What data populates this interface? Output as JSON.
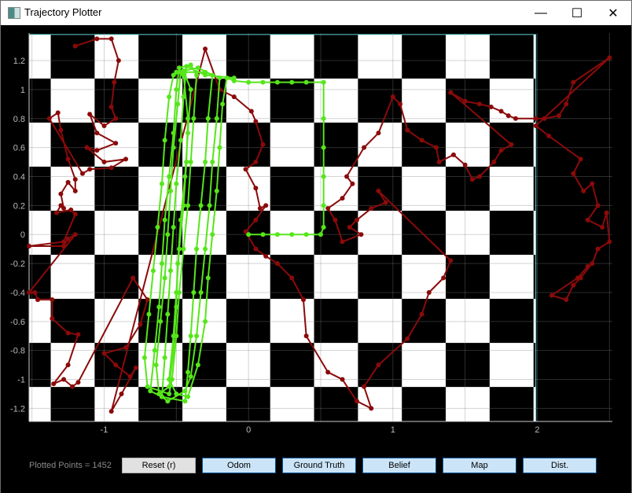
{
  "window": {
    "title": "Trajectory Plotter",
    "controls": {
      "minimize": "—",
      "maximize": "☐",
      "close": "✕"
    }
  },
  "footer": {
    "plotted_points_label": "Plotted Points = 1452",
    "buttons": [
      {
        "label": "Reset (r)",
        "style": "plain",
        "name": "reset-button"
      },
      {
        "label": "Odom",
        "style": "toggle",
        "name": "odom-toggle"
      },
      {
        "label": "Ground Truth",
        "style": "toggle",
        "name": "ground-truth-toggle"
      },
      {
        "label": "Belief",
        "style": "toggle",
        "name": "belief-toggle"
      },
      {
        "label": "Map",
        "style": "toggle",
        "name": "map-toggle"
      },
      {
        "label": "Dist.",
        "style": "toggle",
        "name": "dist-toggle"
      }
    ]
  },
  "colors": {
    "background": "#000000",
    "axis": "#cccccc",
    "board_border": "#5fd3d3",
    "grid": "#3a3a3a",
    "belief": "#8b0a0a",
    "odom": "#55e61a"
  },
  "chart_data": {
    "type": "scatter",
    "title": "",
    "xlabel": "",
    "ylabel": "",
    "xlim": [
      -1.52,
      2.52
    ],
    "ylim": [
      -1.29,
      1.39
    ],
    "x_ticks": [
      -1,
      0,
      1,
      2
    ],
    "y_ticks": [
      -1.2,
      -1,
      -0.8,
      -0.6,
      -0.4,
      -0.2,
      0,
      0.2,
      0.4,
      0.6,
      0.8,
      1,
      1.2
    ],
    "grid": true,
    "map": {
      "type": "checkerboard",
      "x_range": [
        -1.52,
        1.99
      ],
      "y_range": [
        -1.29,
        1.38
      ],
      "square_size": 0.304,
      "origin_corner": [
        -1.37,
        1.38
      ]
    },
    "series": [
      {
        "name": "Odom",
        "color": "#55e61a",
        "points": [
          [
            0,
            0
          ],
          [
            0.1,
            0
          ],
          [
            0.2,
            0
          ],
          [
            0.3,
            0
          ],
          [
            0.4,
            0
          ],
          [
            0.5,
            0
          ],
          [
            0.52,
            0.05
          ],
          [
            0.52,
            0.2
          ],
          [
            0.52,
            0.4
          ],
          [
            0.52,
            0.6
          ],
          [
            0.52,
            0.8
          ],
          [
            0.52,
            1.05
          ],
          [
            0.4,
            1.05
          ],
          [
            0.3,
            1.05
          ],
          [
            0.2,
            1.05
          ],
          [
            0.1,
            1.05
          ],
          [
            0.0,
            1.05
          ],
          [
            -0.1,
            1.06
          ],
          [
            -0.15,
            1.08
          ],
          [
            -0.18,
            0.9
          ],
          [
            -0.2,
            0.6
          ],
          [
            -0.22,
            0.3
          ],
          [
            -0.25,
            0
          ],
          [
            -0.28,
            -0.3
          ],
          [
            -0.3,
            -0.6
          ],
          [
            -0.35,
            -0.9
          ],
          [
            -0.42,
            -1.12
          ],
          [
            -0.5,
            -1.1
          ],
          [
            -0.55,
            -1.0
          ],
          [
            -0.52,
            -0.7
          ],
          [
            -0.5,
            -0.4
          ],
          [
            -0.48,
            -0.1
          ],
          [
            -0.45,
            0.2
          ],
          [
            -0.43,
            0.5
          ],
          [
            -0.42,
            0.8
          ],
          [
            -0.45,
            1.1
          ],
          [
            -0.5,
            1.12
          ],
          [
            -0.35,
            1.15
          ],
          [
            -0.25,
            1.1
          ],
          [
            -0.28,
            0.8
          ],
          [
            -0.3,
            0.5
          ],
          [
            -0.33,
            0.2
          ],
          [
            -0.36,
            -0.1
          ],
          [
            -0.38,
            -0.4
          ],
          [
            -0.4,
            -0.7
          ],
          [
            -0.42,
            -0.95
          ],
          [
            -0.44,
            -1.15
          ],
          [
            -0.6,
            -1.12
          ],
          [
            -0.68,
            -1.08
          ],
          [
            -0.65,
            -0.8
          ],
          [
            -0.62,
            -0.5
          ],
          [
            -0.6,
            -0.2
          ],
          [
            -0.58,
            0.1
          ],
          [
            -0.55,
            0.4
          ],
          [
            -0.52,
            0.7
          ],
          [
            -0.5,
            1.0
          ],
          [
            -0.48,
            1.15
          ],
          [
            -0.4,
            1.17
          ],
          [
            -0.36,
            1.1
          ],
          [
            -0.38,
            0.8
          ],
          [
            -0.4,
            0.5
          ],
          [
            -0.42,
            0.2
          ],
          [
            -0.45,
            -0.1
          ],
          [
            -0.48,
            -0.4
          ],
          [
            -0.5,
            -0.7
          ],
          [
            -0.53,
            -1.0
          ],
          [
            -0.55,
            -1.1
          ],
          [
            -0.7,
            -1.05
          ],
          [
            -0.72,
            -0.85
          ],
          [
            -0.69,
            -0.55
          ],
          [
            -0.66,
            -0.25
          ],
          [
            -0.63,
            0.05
          ],
          [
            -0.6,
            0.35
          ],
          [
            -0.58,
            0.65
          ],
          [
            -0.55,
            0.95
          ],
          [
            -0.52,
            1.1
          ],
          [
            -0.45,
            1.13
          ],
          [
            -0.4,
            1.0
          ],
          [
            -0.42,
            0.7
          ],
          [
            -0.44,
            0.4
          ],
          [
            -0.47,
            0.1
          ],
          [
            -0.49,
            -0.2
          ],
          [
            -0.5,
            -0.5
          ],
          [
            -0.52,
            -0.8
          ],
          [
            -0.55,
            -1.05
          ],
          [
            -0.62,
            -1.1
          ],
          [
            -0.64,
            -0.9
          ],
          [
            -0.61,
            -0.6
          ],
          [
            -0.58,
            -0.3
          ],
          [
            -0.56,
            0
          ],
          [
            -0.54,
            0.3
          ],
          [
            -0.52,
            0.6
          ],
          [
            -0.49,
            0.9
          ],
          [
            -0.47,
            1.12
          ],
          [
            -0.3,
            1.12
          ],
          [
            -0.2,
            1.08
          ],
          [
            -0.22,
            0.8
          ],
          [
            -0.25,
            0.5
          ],
          [
            -0.27,
            0.2
          ],
          [
            -0.3,
            -0.1
          ],
          [
            -0.33,
            -0.4
          ],
          [
            -0.36,
            -0.7
          ],
          [
            -0.4,
            -0.98
          ],
          [
            -0.44,
            -1.08
          ],
          [
            -0.56,
            -1.15
          ],
          [
            -0.6,
            -1.12
          ],
          [
            -0.58,
            -0.85
          ],
          [
            -0.56,
            -0.55
          ],
          [
            -0.54,
            -0.25
          ],
          [
            -0.52,
            0.05
          ],
          [
            -0.5,
            0.35
          ],
          [
            -0.47,
            0.65
          ],
          [
            -0.45,
            0.95
          ],
          [
            -0.43,
            1.16
          ],
          [
            -0.3,
            1.1
          ],
          [
            -0.1,
            1.08
          ]
        ]
      },
      {
        "name": "Belief",
        "color": "#8b0a0a",
        "points": [
          [
            -1.2,
            1.3
          ],
          [
            -1.05,
            1.35
          ],
          [
            -0.95,
            1.35
          ],
          [
            -0.9,
            1.2
          ],
          [
            -0.93,
            1.05
          ],
          [
            -0.95,
            0.88
          ],
          [
            -0.92,
            0.8
          ],
          [
            -1.0,
            0.75
          ],
          [
            -1.1,
            0.83
          ],
          [
            -1.05,
            0.7
          ],
          [
            -0.92,
            0.63
          ],
          [
            -1.05,
            0.58
          ],
          [
            -1.12,
            0.6
          ],
          [
            -1.0,
            0.5
          ],
          [
            -0.85,
            0.52
          ],
          [
            -0.95,
            0.46
          ],
          [
            -1.1,
            0.45
          ],
          [
            -1.15,
            0.42
          ],
          [
            -1.38,
            0.8
          ],
          [
            -1.32,
            0.84
          ],
          [
            -1.3,
            0.72
          ],
          [
            -1.25,
            0.52
          ],
          [
            -1.2,
            0.38
          ],
          [
            -1.2,
            0.3
          ],
          [
            -1.25,
            0.36
          ],
          [
            -1.3,
            0.28
          ],
          [
            -1.28,
            0.18
          ],
          [
            -1.3,
            0.2
          ],
          [
            -1.33,
            0.15
          ],
          [
            -1.23,
            0.17
          ],
          [
            -1.2,
            0.14
          ],
          [
            -1.28,
            -0.05
          ],
          [
            -1.52,
            -0.08
          ],
          [
            -1.28,
            -0.08
          ],
          [
            -1.25,
            -0.03
          ],
          [
            -1.2,
            0
          ],
          [
            -1.52,
            -0.4
          ],
          [
            -1.48,
            -0.4
          ],
          [
            -1.46,
            -0.45
          ],
          [
            -1.36,
            -0.45
          ],
          [
            -1.36,
            -0.58
          ],
          [
            -1.25,
            -0.68
          ],
          [
            -1.18,
            -0.69
          ],
          [
            -1.25,
            -0.9
          ],
          [
            -1.35,
            -1.03
          ],
          [
            -1.28,
            -1.0
          ],
          [
            -1.22,
            -1.05
          ],
          [
            -1.18,
            -1.02
          ],
          [
            -0.8,
            -0.3
          ],
          [
            -0.7,
            -0.45
          ],
          [
            -0.75,
            -0.62
          ],
          [
            -0.85,
            -0.78
          ],
          [
            -1.0,
            -0.82
          ],
          [
            -0.92,
            -0.9
          ],
          [
            -0.82,
            -0.98
          ],
          [
            -0.78,
            -0.92
          ],
          [
            -0.88,
            -1.1
          ],
          [
            -0.95,
            -1.22
          ],
          [
            -0.3,
            1.28
          ],
          [
            -0.2,
            1.0
          ],
          [
            -0.1,
            0.95
          ],
          [
            0.02,
            0.85
          ],
          [
            0.05,
            0.78
          ],
          [
            0.1,
            0.62
          ],
          [
            0.05,
            0.5
          ],
          [
            -0.02,
            0.45
          ],
          [
            0.05,
            0.32
          ],
          [
            0.08,
            0.18
          ],
          [
            0.12,
            0.2
          ],
          [
            0.05,
            0.1
          ],
          [
            -0.02,
            0.02
          ],
          [
            0.05,
            -0.1
          ],
          [
            0.12,
            -0.15
          ],
          [
            0.2,
            -0.2
          ],
          [
            0.3,
            -0.3
          ],
          [
            0.38,
            -0.45
          ],
          [
            0.4,
            -0.7
          ],
          [
            0.55,
            -0.95
          ],
          [
            0.65,
            -1.0
          ],
          [
            0.75,
            -1.15
          ],
          [
            0.85,
            -1.2
          ],
          [
            0.8,
            -1.05
          ],
          [
            0.9,
            -0.9
          ],
          [
            1.1,
            -0.72
          ],
          [
            1.2,
            -0.55
          ],
          [
            1.25,
            -0.4
          ],
          [
            1.35,
            -0.3
          ],
          [
            1.4,
            -0.18
          ],
          [
            0.9,
            0.3
          ],
          [
            0.95,
            0.22
          ],
          [
            0.85,
            0.18
          ],
          [
            0.75,
            0.1
          ],
          [
            0.7,
            0.05
          ],
          [
            0.78,
            0
          ],
          [
            0.65,
            -0.05
          ],
          [
            0.6,
            0.1
          ],
          [
            0.55,
            0.18
          ],
          [
            0.65,
            0.25
          ],
          [
            0.72,
            0.35
          ],
          [
            0.68,
            0.4
          ],
          [
            0.8,
            0.6
          ],
          [
            0.9,
            0.7
          ],
          [
            1.0,
            0.95
          ],
          [
            1.05,
            0.9
          ],
          [
            1.1,
            0.72
          ],
          [
            1.2,
            0.65
          ],
          [
            1.3,
            0.6
          ],
          [
            1.32,
            0.5
          ],
          [
            1.42,
            0.55
          ],
          [
            1.5,
            0.48
          ],
          [
            1.55,
            0.38
          ],
          [
            1.6,
            0.4
          ],
          [
            1.7,
            0.5
          ],
          [
            1.75,
            0.58
          ],
          [
            1.82,
            0.62
          ],
          [
            1.4,
            0.98
          ],
          [
            1.5,
            0.92
          ],
          [
            1.6,
            0.9
          ],
          [
            1.68,
            0.88
          ],
          [
            1.75,
            0.85
          ],
          [
            1.8,
            0.82
          ],
          [
            1.85,
            0.8
          ],
          [
            1.99,
            0.8
          ],
          [
            2.05,
            0.8
          ],
          [
            2.15,
            0.82
          ],
          [
            2.2,
            0.9
          ],
          [
            2.25,
            1.05
          ],
          [
            2.5,
            1.22
          ],
          [
            1.99,
            0.75
          ],
          [
            2.08,
            0.68
          ],
          [
            2.3,
            0.52
          ],
          [
            2.25,
            0.42
          ],
          [
            2.32,
            0.3
          ],
          [
            2.38,
            0.35
          ],
          [
            2.42,
            0.2
          ],
          [
            2.35,
            0.1
          ],
          [
            2.45,
            0.05
          ],
          [
            2.48,
            0.15
          ],
          [
            2.5,
            -0.05
          ],
          [
            2.42,
            -0.1
          ],
          [
            2.38,
            -0.2
          ],
          [
            2.3,
            -0.3
          ],
          [
            2.25,
            -0.35
          ],
          [
            2.2,
            -0.45
          ],
          [
            2.1,
            -0.42
          ],
          [
            2.28,
            -0.3
          ],
          [
            2.35,
            -0.22
          ]
        ]
      }
    ]
  }
}
